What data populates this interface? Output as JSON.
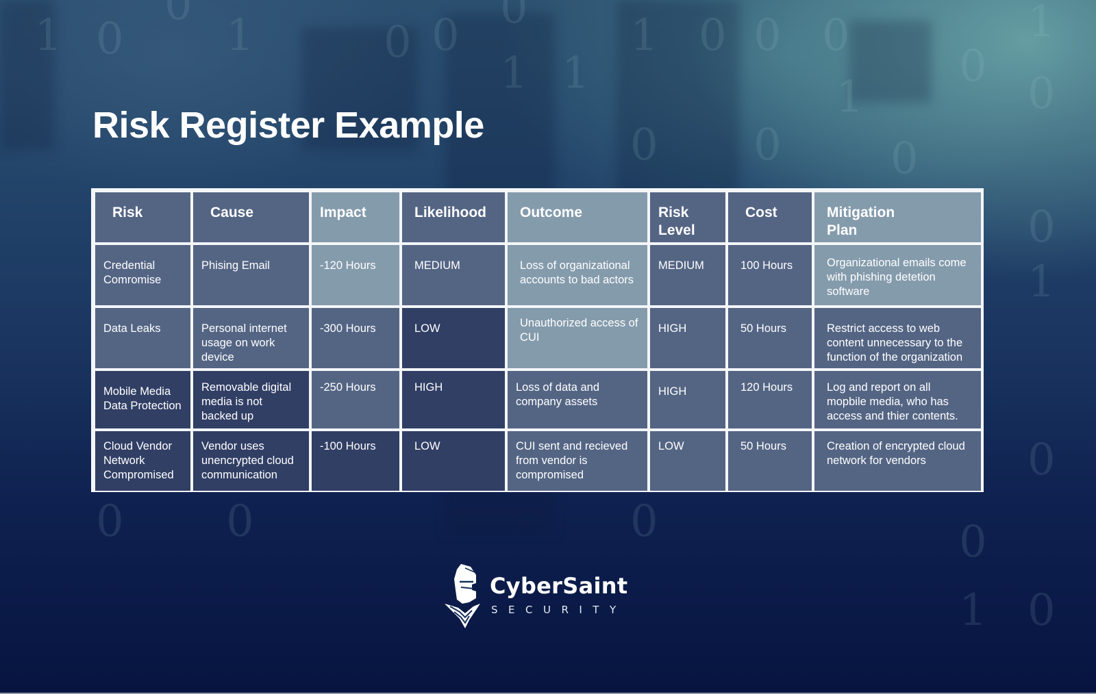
{
  "title": "Risk Register Example",
  "table": {
    "headers": [
      "Risk",
      "Cause",
      "Impact",
      "Likelihood",
      "Outcome",
      "Risk\nLevel",
      "Cost",
      "Mitigation\nPlan"
    ],
    "rows": [
      [
        "Credential Comromise",
        "Phising Email",
        "-120 Hours",
        "MEDIUM",
        "Loss of organizational accounts to bad actors",
        "MEDIUM",
        "100 Hours",
        "Organizational emails come with phishing detetion software"
      ],
      [
        "Data Leaks",
        "Personal internet usage on work device",
        "-300 Hours",
        "LOW",
        "Unauthorized access of CUI",
        "HIGH",
        "50 Hours",
        "Restrict access to web content unnecessary to the function of the organization"
      ],
      [
        "Mobile Media Data Protection",
        "Removable digital media is not backed up",
        "-250 Hours",
        "HIGH",
        "Loss of data and company assets",
        "HIGH",
        "120 Hours",
        "Log and report on all mopbile media, who has access and thier contents."
      ],
      [
        "Cloud Vendor Network Compromised",
        "Vendor uses unencrypted cloud communication",
        "-100 Hours",
        "LOW",
        "CUI sent and recieved from vendor is compromised",
        "LOW",
        "50 Hours",
        "Creation of encrypted cloud network for vendors"
      ]
    ]
  },
  "logo": {
    "name": "CyberSaint",
    "tagline": "SECURITY",
    "icon": "knight-helmet-icon"
  },
  "colors": {
    "text": "#ffffff",
    "table_border": "#f4f6f8",
    "cell_bg": "#162d58",
    "bg_top_right": "#6eaaaa",
    "bg_bottom": "#071440"
  }
}
